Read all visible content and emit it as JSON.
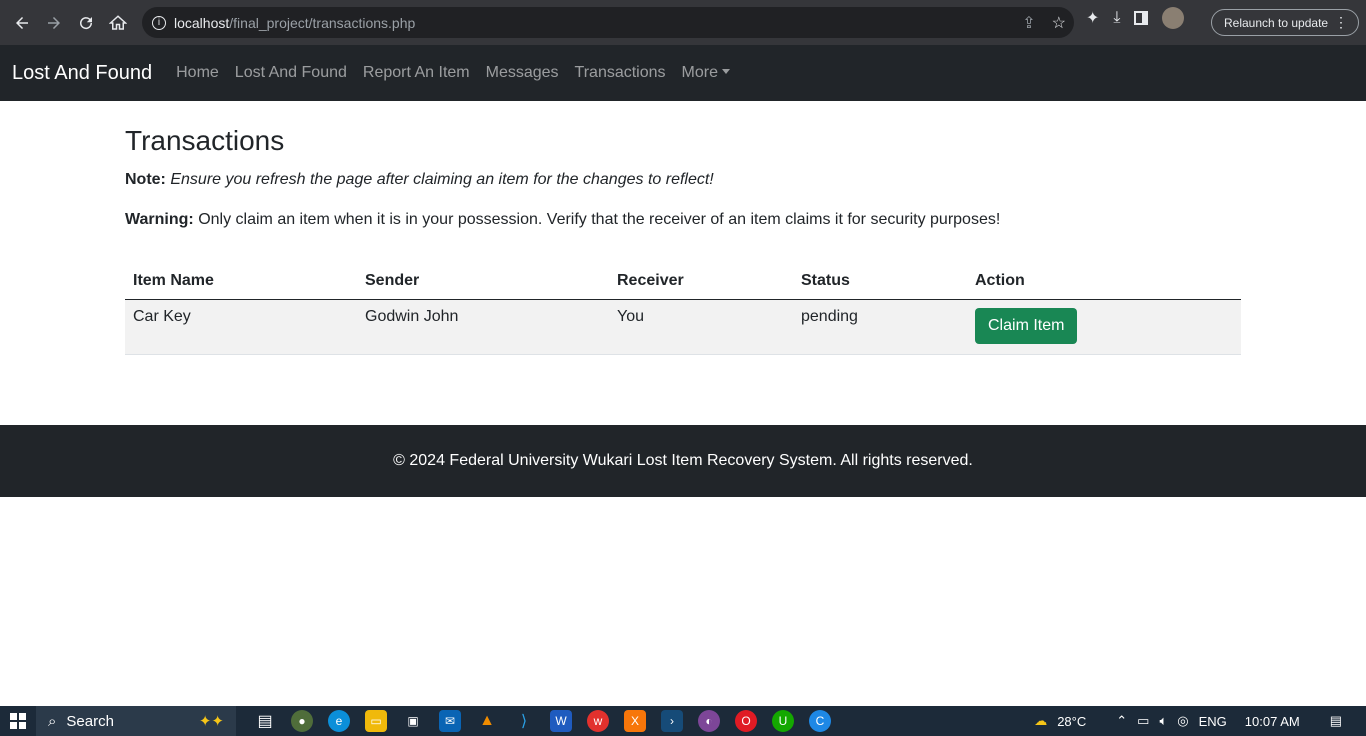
{
  "browser": {
    "url_host": "localhost",
    "url_path": "/final_project/transactions.php",
    "relaunch_label": "Relaunch to update",
    "menu_glyph": "⋮"
  },
  "navbar": {
    "brand": "Lost And Found",
    "links": [
      "Home",
      "Lost And Found",
      "Report An Item",
      "Messages",
      "Transactions",
      "More"
    ]
  },
  "main": {
    "title": "Transactions",
    "note_label": "Note:",
    "note_text": "Ensure you refresh the page after claiming an item for the changes to reflect!",
    "warning_label": "Warning:",
    "warning_text": "Only claim an item when it is in your possession. Verify that the receiver of an item claims it for security purposes!",
    "table": {
      "headers": [
        "Item Name",
        "Sender",
        "Receiver",
        "Status",
        "Action"
      ],
      "rows": [
        {
          "item": "Car Key",
          "sender": "Godwin John",
          "receiver": "You",
          "status": "pending",
          "action": "Claim Item"
        }
      ]
    }
  },
  "footer": {
    "text": "© 2024 Federal University Wukari Lost Item Recovery System. All rights reserved."
  },
  "taskbar": {
    "search_label": "Search",
    "weather": "28°C",
    "language": "ENG",
    "time": "10:07 AM"
  },
  "colors": {
    "navbar_bg": "#212529",
    "claim_button": "#198754",
    "browser_bg": "#35363a"
  }
}
